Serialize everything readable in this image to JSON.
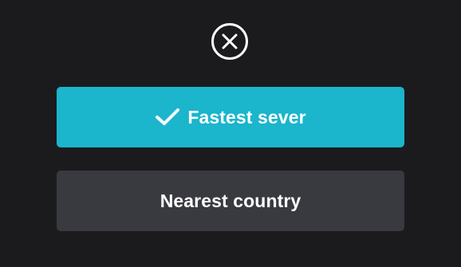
{
  "dialog": {
    "close_icon": "close-circle-icon",
    "options": [
      {
        "label": "Fastest sever",
        "selected": true,
        "icon": "checkmark-icon"
      },
      {
        "label": "Nearest country",
        "selected": false
      }
    ]
  },
  "colors": {
    "background": "#1b1b1d",
    "selected_option": "#1bb5cc",
    "unselected_option": "#393940",
    "text": "#ffffff"
  }
}
